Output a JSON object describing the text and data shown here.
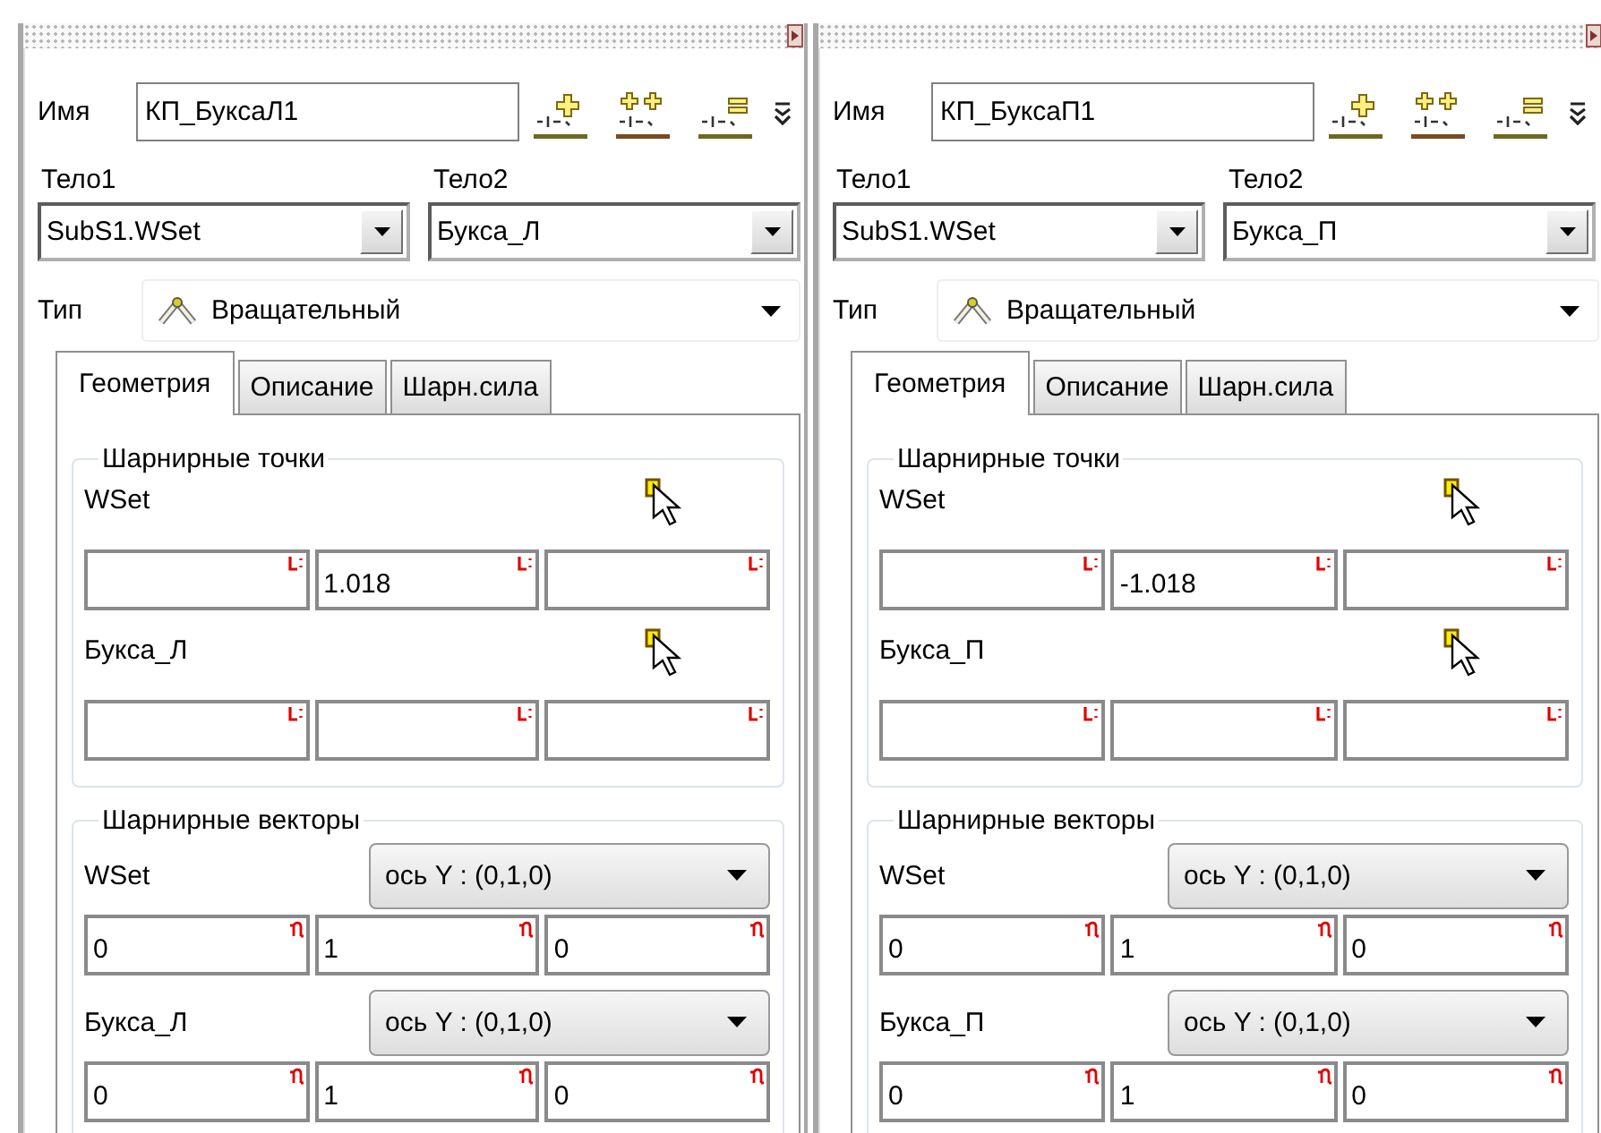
{
  "panels": [
    {
      "name_label": "Имя",
      "name": "КП_БуксаЛ1",
      "body1_label": "Тело1",
      "body2_label": "Тело2",
      "body1": "SubS1.WSet",
      "body2": "Букса_Л",
      "type_label": "Тип",
      "type": "Вращательный",
      "tabs": [
        {
          "label": "Геометрия",
          "selected": true
        },
        {
          "label": "Описание",
          "selected": false
        },
        {
          "label": "Шарн.сила",
          "selected": false
        }
      ],
      "points": {
        "title": "Шарнирные точки",
        "rows": [
          {
            "label": "WSet",
            "field_2": "1.018"
          },
          {
            "label": "Букса_Л"
          }
        ]
      },
      "vectors": {
        "title": "Шарнирные векторы",
        "rows": [
          {
            "label": "WSet",
            "axis": "ось Y : (0,1,0)",
            "values": [
              "0",
              "1",
              "0"
            ]
          },
          {
            "label": "Букса_Л",
            "axis": "ось Y : (0,1,0)",
            "values": [
              "0",
              "1",
              "0"
            ]
          }
        ]
      }
    },
    {
      "name_label": "Имя",
      "name": "КП_БуксаП1",
      "body1_label": "Тело1",
      "body2_label": "Тело2",
      "body1": "SubS1.WSet",
      "body2": "Букса_П",
      "type_label": "Тип",
      "type": "Вращательный",
      "tabs": [
        {
          "label": "Геометрия",
          "selected": true
        },
        {
          "label": "Описание",
          "selected": false
        },
        {
          "label": "Шарн.сила",
          "selected": false
        }
      ],
      "points": {
        "title": "Шарнирные точки",
        "rows": [
          {
            "label": "WSet",
            "field_2": "-1.018"
          },
          {
            "label": "Букса_П"
          }
        ]
      },
      "vectors": {
        "title": "Шарнирные векторы",
        "rows": [
          {
            "label": "WSet",
            "axis": "ось Y : (0,1,0)",
            "values": [
              "0",
              "1",
              "0"
            ]
          },
          {
            "label": "Букса_П",
            "axis": "ось Y : (0,1,0)",
            "values": [
              "0",
              "1",
              "0"
            ]
          }
        ]
      }
    }
  ]
}
